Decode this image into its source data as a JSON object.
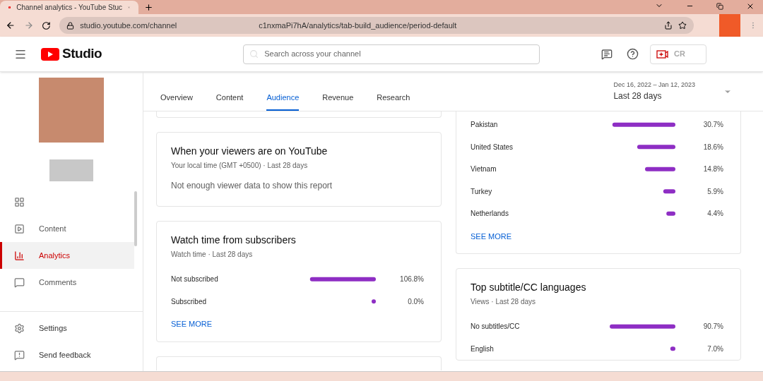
{
  "browser": {
    "tab_title": "Channel analytics - YouTube Stuc",
    "url_start": "studio.youtube.com/channel",
    "url_end": "c1nxmaPi7hA/analytics/tab-build_audience/period-default"
  },
  "header": {
    "logo": "Studio",
    "search_placeholder": "Search across your channel",
    "create_label": "CR"
  },
  "sidebar": {
    "items": [
      {
        "selected": false
      },
      {
        "label": "Content",
        "selected": false
      },
      {
        "label": "Analytics",
        "selected": true
      },
      {
        "label": "Comments",
        "selected": false
      }
    ],
    "bottom_items": [
      {
        "label": "Settings"
      },
      {
        "label": "Send feedback"
      }
    ]
  },
  "tabs": [
    {
      "label": "Overview",
      "selected": false
    },
    {
      "label": "Content",
      "selected": false
    },
    {
      "label": "Audience",
      "selected": true
    },
    {
      "label": "Revenue",
      "selected": false
    },
    {
      "label": "Research",
      "selected": false
    }
  ],
  "period": {
    "range": "Dec 16, 2022 – Jan 12, 2023",
    "label": "Last 28 days"
  },
  "left_cards": [
    {
      "title": "When your viewers are on YouTube",
      "subtitle": "Your local time (GMT +0500) · Last 28 days",
      "message": "Not enough viewer data to show this report"
    },
    {
      "title": "Watch time from subscribers",
      "subtitle": "Watch time · Last 28 days",
      "chart_data": {
        "type": "bar",
        "orientation": "horizontal",
        "categories": [
          "Not subscribed",
          "Subscribed"
        ],
        "values": [
          106.8,
          0.0
        ],
        "value_labels": [
          "106.8%",
          "0.0%"
        ]
      },
      "link": "SEE MORE"
    }
  ],
  "right_cards": [
    {
      "chart_data": {
        "type": "bar",
        "orientation": "horizontal",
        "categories": [
          "Pakistan",
          "United States",
          "Vietnam",
          "Turkey",
          "Netherlands"
        ],
        "values": [
          30.7,
          18.6,
          14.8,
          5.9,
          4.4
        ],
        "value_labels": [
          "30.7%",
          "18.6%",
          "14.8%",
          "5.9%",
          "4.4%"
        ]
      },
      "link": "SEE MORE"
    },
    {
      "title": "Top subtitle/CC languages",
      "subtitle": "Views · Last 28 days",
      "chart_data": {
        "type": "bar",
        "orientation": "horizontal",
        "categories": [
          "No subtitles/CC",
          "English"
        ],
        "values": [
          90.7,
          7.0
        ],
        "value_labels": [
          "90.7%",
          "7.0%"
        ]
      }
    }
  ]
}
